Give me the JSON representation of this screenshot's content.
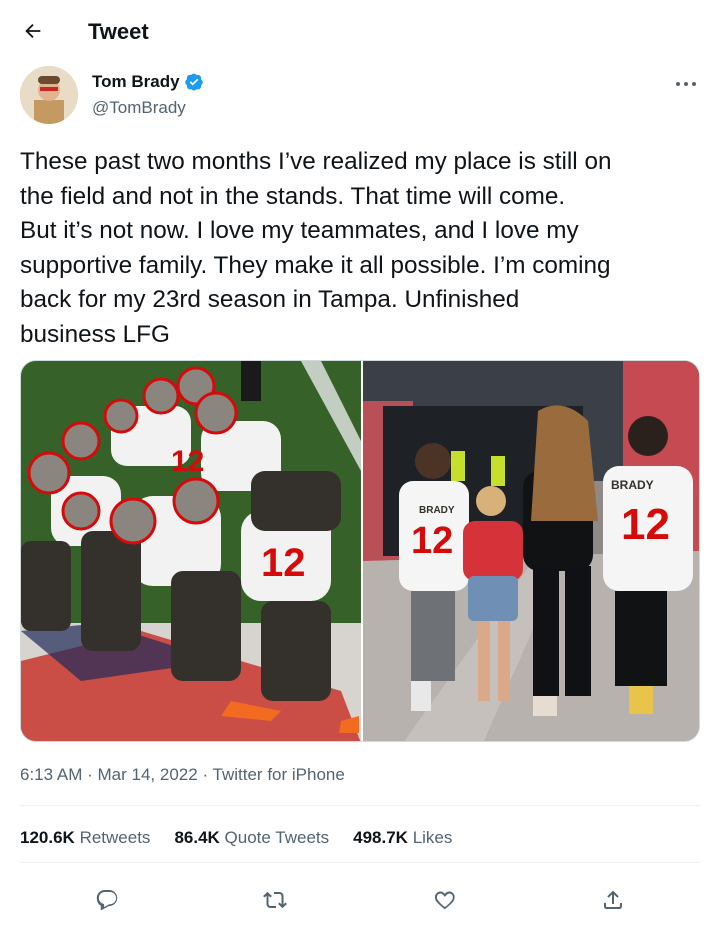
{
  "header": {
    "title": "Tweet"
  },
  "author": {
    "display_name": "Tom Brady",
    "handle": "@TomBrady",
    "verified": true
  },
  "tweet": {
    "text": "These past two months I’ve realized my place is still on\nthe field and not in the stands. That time will come.\nBut it’s not now. I love my teammates, and I love my\nsupportive family. They make it all possible. I’m coming\nback for my 23rd season in Tampa. Unfinished\nbusiness LFG",
    "time": "6:13 AM",
    "date": "Mar 14, 2022",
    "source": "Twitter for iPhone",
    "separator": "·"
  },
  "media": {
    "left": {
      "jersey_text": "12"
    },
    "right": {
      "jersey_name": "BRADY",
      "jersey_number": "12",
      "jersey_name_small": "BRADY",
      "jersey_number_small": "12"
    }
  },
  "stats": {
    "retweets": {
      "count": "120.6K",
      "label": "Retweets"
    },
    "quotes": {
      "count": "86.4K",
      "label": "Quote Tweets"
    },
    "likes": {
      "count": "498.7K",
      "label": "Likes"
    }
  },
  "actions": [
    "reply-icon",
    "retweet-icon",
    "like-icon",
    "share-icon"
  ],
  "colors": {
    "verified": "#1d9bf0",
    "secondary": "#536471",
    "primary": "#0f1419",
    "bucs_red": "#d50a0a",
    "pewter": "#34302b"
  }
}
